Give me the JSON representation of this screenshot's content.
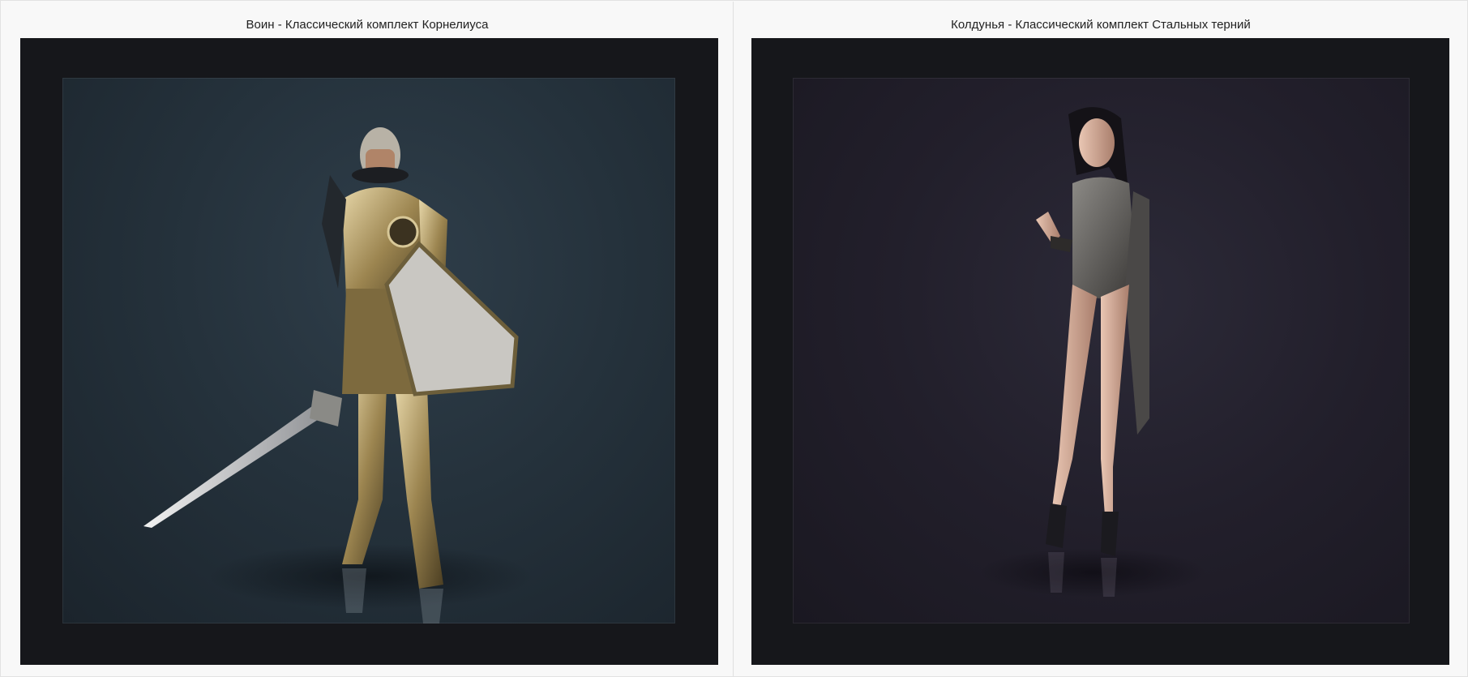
{
  "gallery": {
    "items": [
      {
        "caption": "Воин - Классический комплект Корнелиуса"
      },
      {
        "caption": "Колдунья - Классический комплект Стальных терний"
      }
    ]
  },
  "colors": {
    "page_background": "#f8f8f8",
    "frame_background": "#16171b",
    "left_stage": "#27343e",
    "right_stage": "#23202c"
  }
}
